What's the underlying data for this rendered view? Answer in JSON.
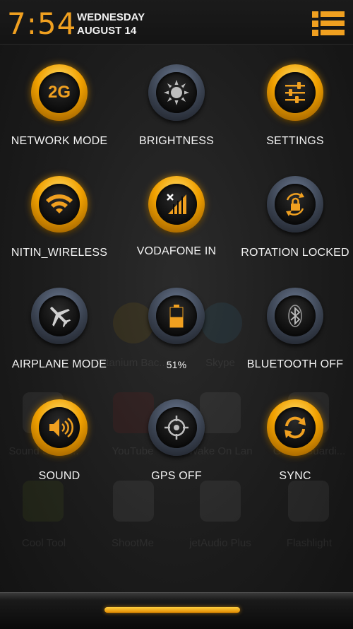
{
  "status": {
    "time": "7:54",
    "weekday": "WEDNESDAY",
    "date": "AUGUST 14"
  },
  "accent_color": "#f0a020",
  "menu_icon": "list-menu-icon",
  "toggles": [
    {
      "label": "NETWORK MODE",
      "icon": "2g-icon",
      "glyph": "2G",
      "state": "on"
    },
    {
      "label": "BRIGHTNESS",
      "icon": "brightness-sun-icon",
      "state": "off"
    },
    {
      "label": "SETTINGS",
      "icon": "settings-sliders-icon",
      "state": "on"
    },
    {
      "label": "NITIN_WIRELESS",
      "icon": "wifi-icon",
      "state": "on"
    },
    {
      "label": "VODAFONE IN",
      "icon": "signal-icon",
      "state": "on"
    },
    {
      "label": "ROTATION LOCKED",
      "icon": "rotation-lock-icon",
      "state": "off"
    },
    {
      "label": "AIRPLANE MODE",
      "icon": "airplane-icon",
      "state": "off"
    },
    {
      "label": "51%",
      "icon": "battery-icon",
      "state": "off",
      "battery_level": 0.51
    },
    {
      "label": "BLUETOOTH OFF",
      "icon": "bluetooth-icon",
      "state": "off"
    },
    {
      "label": "SOUND",
      "icon": "speaker-icon",
      "state": "on"
    },
    {
      "label": "GPS OFF",
      "icon": "gps-crosshair-icon",
      "state": "off"
    },
    {
      "label": "SYNC",
      "icon": "sync-icon",
      "state": "on"
    }
  ],
  "background_apps": [
    "Titanium Bac...",
    "Skype",
    "Sound Searc...",
    "YouTube",
    "Wake On Lan",
    "Game Guardi...",
    "Cool Tool",
    "ShootMe",
    "jetAudio Plus",
    "Flashlight"
  ]
}
